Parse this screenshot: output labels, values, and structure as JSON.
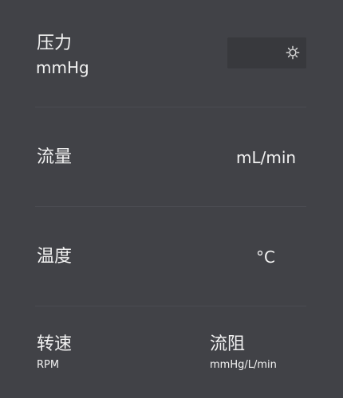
{
  "rows": {
    "pressure": {
      "label": "压力",
      "unit": "mmHg",
      "settings_icon": "gear-icon"
    },
    "flow": {
      "label": "流量",
      "unit": "mL/min"
    },
    "temperature": {
      "label": "温度",
      "unit": "°C"
    },
    "speed": {
      "label": "转速",
      "unit": "RPM"
    },
    "resistance": {
      "label": "流阻",
      "unit": "mmHg/L/min"
    }
  },
  "colors": {
    "background": "#414247",
    "divider": "#4b4c52",
    "text": "#f2f2f2",
    "control_box": "#38393d",
    "icon": "#d7d7d7"
  }
}
